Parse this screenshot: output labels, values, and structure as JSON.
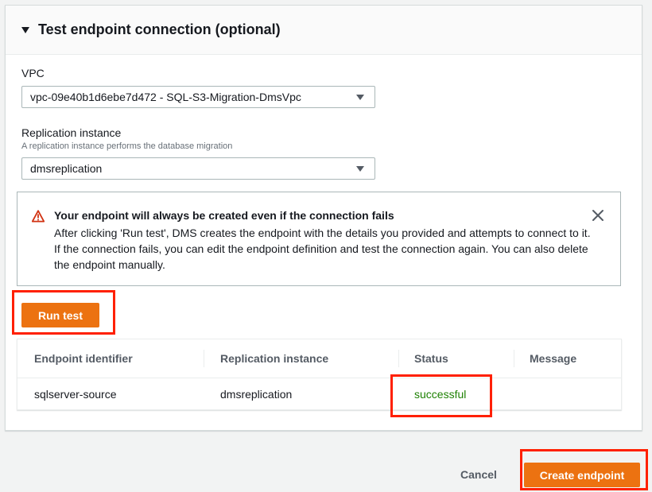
{
  "section": {
    "title": "Test endpoint connection (optional)"
  },
  "vpc": {
    "label": "VPC",
    "value": "vpc-09e40b1d6ebe7d472 - SQL-S3-Migration-DmsVpc"
  },
  "replication": {
    "label": "Replication instance",
    "description": "A replication instance performs the database migration",
    "value": "dmsreplication"
  },
  "alert": {
    "title": "Your endpoint will always be created even if the connection fails",
    "body": "After clicking 'Run test', DMS creates the endpoint with the details you provided and attempts to connect to it. If the connection fails, you can edit the endpoint definition and test the connection again. You can also delete the endpoint manually."
  },
  "actions": {
    "run_test": "Run test",
    "cancel": "Cancel",
    "create_endpoint": "Create endpoint"
  },
  "results_table": {
    "headers": [
      "Endpoint identifier",
      "Replication instance",
      "Status",
      "Message"
    ],
    "rows": [
      [
        "sqlserver-source",
        "dmsreplication",
        "successful",
        ""
      ]
    ]
  },
  "colors": {
    "primary": "#ec7211",
    "success": "#1d8102",
    "highlight": "#ff2000",
    "warning": "#d13212"
  },
  "icons": {
    "section_toggle": "caret-down-icon",
    "alert": "warning-icon",
    "dismiss": "close-icon",
    "select": "chevron-down-icon"
  }
}
